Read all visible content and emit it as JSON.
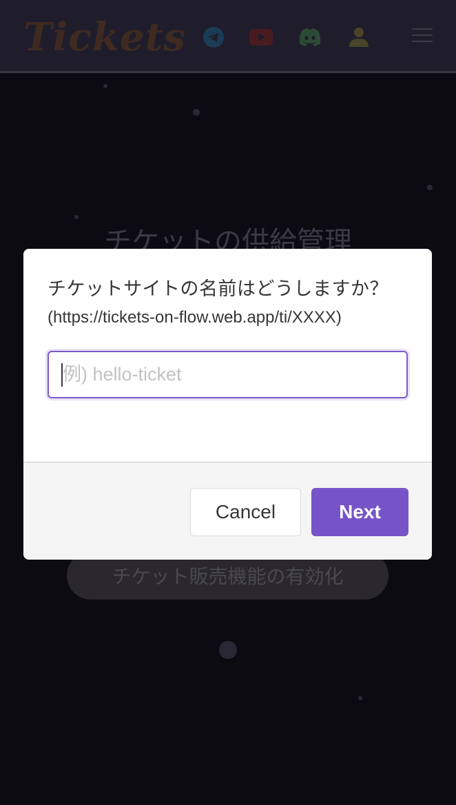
{
  "header": {
    "brand": "Tickets",
    "icons": [
      "telegram-icon",
      "youtube-icon",
      "discord-icon",
      "user-icon",
      "menu-icon"
    ]
  },
  "background": {
    "title": "チケットの供給管理",
    "button_label": "チケット販売機能の有効化"
  },
  "modal": {
    "title": "チケットサイトの名前はどうしますか？",
    "url_hint": "(https://tickets-on-flow.web.app/ti/XXXX)",
    "input_value": "",
    "input_placeholder": "例) hello-ticket",
    "cancel_label": "Cancel",
    "next_label": "Next"
  },
  "colors": {
    "accent": "#7654c8",
    "navbar": "#1f1d2b",
    "backdrop": "#0d0b12"
  }
}
